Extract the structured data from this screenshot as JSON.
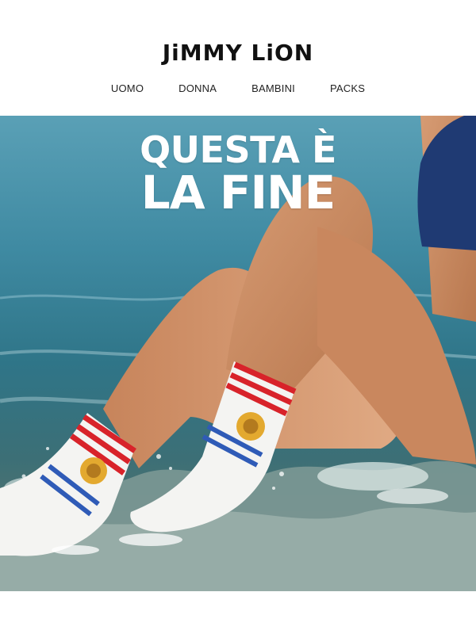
{
  "brand": {
    "logo_text": "JiMMY LiON"
  },
  "nav": {
    "items": [
      {
        "label": "UOMO"
      },
      {
        "label": "DONNA"
      },
      {
        "label": "BAMBINI"
      },
      {
        "label": "PACKS"
      }
    ]
  },
  "hero": {
    "title_line1": "QUESTA È",
    "title_line2": "LA FINE",
    "image_subject": "sock-legs-in-sea"
  },
  "colors": {
    "stripe_red": "#d8232a",
    "stripe_blue": "#2f5bb7",
    "sock_white": "#f4f4f2",
    "sea": "#3f8aa2",
    "skin": "#c88a62"
  }
}
